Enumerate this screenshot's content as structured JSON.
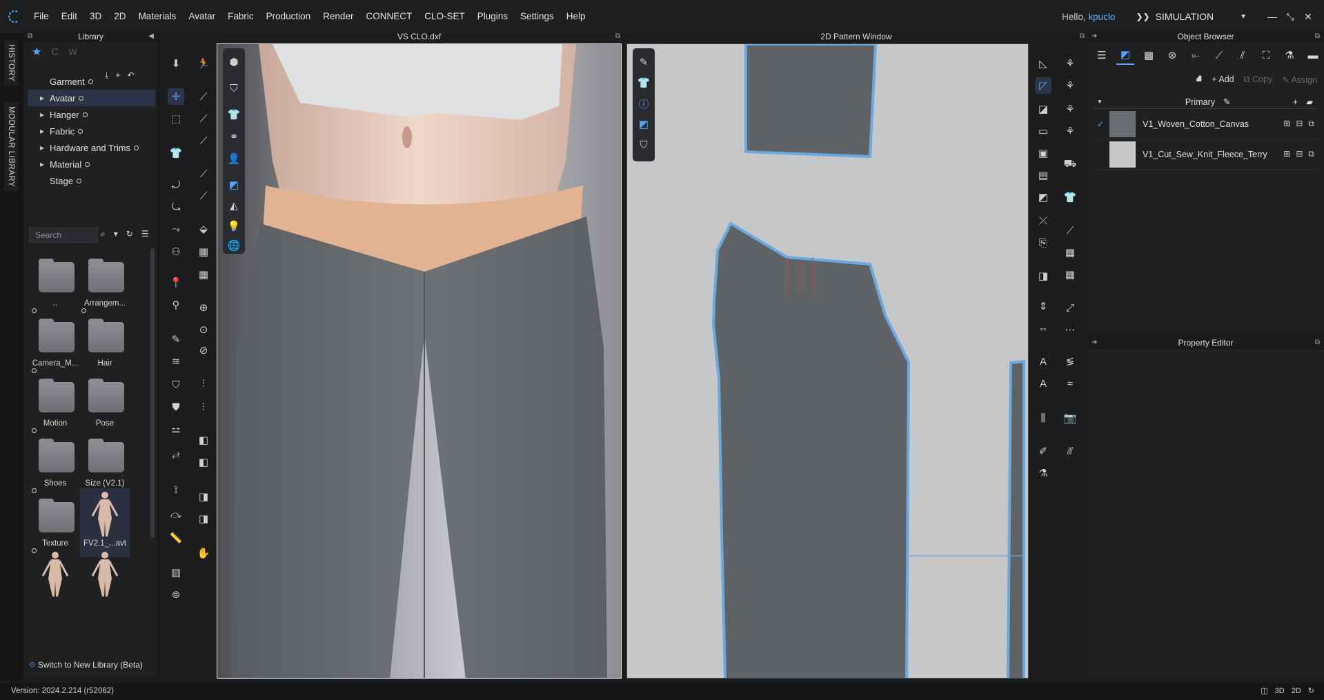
{
  "menu": {
    "items": [
      "File",
      "Edit",
      "3D",
      "2D",
      "Materials",
      "Avatar",
      "Fabric",
      "Production",
      "Render",
      "CONNECT",
      "CLO-SET",
      "Plugins",
      "Settings",
      "Help"
    ],
    "greeting": "Hello,",
    "username": "kpuclo",
    "mode": "SIMULATION"
  },
  "side_tabs": {
    "history": "HISTORY",
    "modular": "MODULAR LIBRARY"
  },
  "library": {
    "title": "Library",
    "tree": [
      {
        "label": "Garment",
        "expandable": false
      },
      {
        "label": "Avatar",
        "expandable": true,
        "selected": true
      },
      {
        "label": "Hanger",
        "expandable": true
      },
      {
        "label": "Fabric",
        "expandable": true
      },
      {
        "label": "Hardware and Trims",
        "expandable": true
      },
      {
        "label": "Material",
        "expandable": true
      },
      {
        "label": "Stage",
        "expandable": false
      }
    ],
    "search_placeholder": "Search",
    "tiles": [
      {
        "label": "..",
        "kind": "folder"
      },
      {
        "label": "Arrangem...",
        "kind": "folder"
      },
      {
        "label": "Camera_M...",
        "kind": "folder"
      },
      {
        "label": "Hair",
        "kind": "folder"
      },
      {
        "label": "Motion",
        "kind": "folder"
      },
      {
        "label": "Pose",
        "kind": "folder"
      },
      {
        "label": "Shoes",
        "kind": "folder"
      },
      {
        "label": "Size (V2.1)",
        "kind": "folder"
      },
      {
        "label": "Texture",
        "kind": "folder"
      },
      {
        "label": "FV2.1_...avt",
        "kind": "avatar"
      },
      {
        "label": "",
        "kind": "avatar"
      },
      {
        "label": "",
        "kind": "avatar"
      }
    ],
    "footer": "Switch to New Library (Beta)"
  },
  "viewport3d": {
    "title": "VS CLO.dxf"
  },
  "viewport2d": {
    "title": "2D Pattern Window"
  },
  "object_browser": {
    "title": "Object Browser",
    "add_label": "Add",
    "copy_label": "Copy",
    "assign_label": "Assign",
    "section": "Primary",
    "fabrics": [
      {
        "name": "V1_Woven_Cotton_Canvas",
        "color": "#6b6e70",
        "checked": true
      },
      {
        "name": "V1_Cut_Sew_Knit_Fleece_Terry",
        "color": "#c7c8ca",
        "checked": false
      }
    ]
  },
  "property_editor": {
    "title": "Property Editor"
  },
  "status": {
    "version": "Version: 2024.2.214 (r52062)"
  }
}
